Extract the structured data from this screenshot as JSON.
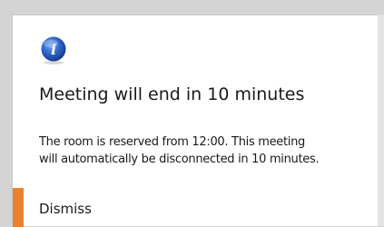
{
  "dialog": {
    "icon": "info-icon",
    "icon_letter": "i",
    "title": "Meeting will end in 10 minutes",
    "message_line1": "The room is reserved from 12:00. This meeting",
    "message_line2": "will automatically be disconnected in 10 minutes.",
    "dismiss_label": "Dismiss"
  },
  "colors": {
    "accent": "#e8822f",
    "icon_blue": "#1f55b3",
    "background": "#ffffff"
  }
}
